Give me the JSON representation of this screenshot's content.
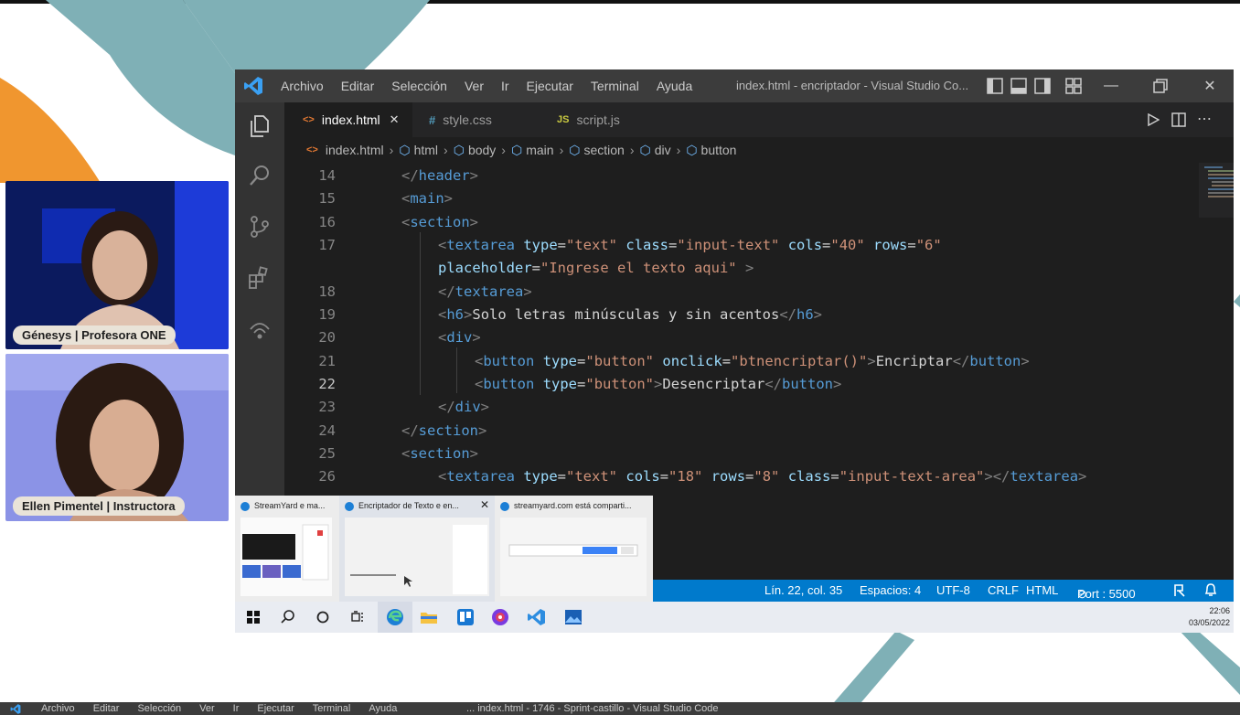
{
  "webcams": [
    {
      "name_tag": "Génesys | Profesora ONE"
    },
    {
      "name_tag": "Ellen Pimentel | Instructora"
    }
  ],
  "vscode": {
    "menu": [
      "Archivo",
      "Editar",
      "Selección",
      "Ver",
      "Ir",
      "Ejecutar",
      "Terminal",
      "Ayuda"
    ],
    "window_title": "index.html - encriptador - Visual Studio Co...",
    "tabs": [
      {
        "icon": "<>",
        "label": "index.html",
        "close": "✕",
        "active": true
      },
      {
        "icon": "#",
        "label": "style.css",
        "active": false
      },
      {
        "icon": "JS",
        "label": "script.js",
        "active": false
      }
    ],
    "breadcrumb": [
      "index.html",
      "html",
      "body",
      "main",
      "section",
      "div",
      "button"
    ],
    "line_numbers": [
      "14",
      "15",
      "16",
      "17",
      "",
      "18",
      "19",
      "20",
      "21",
      "22",
      "23",
      "24",
      "25",
      "26"
    ],
    "current_line": "22",
    "status": {
      "position": "Lín. 22, col. 35",
      "spaces": "Espacios: 4",
      "encoding": "UTF-8",
      "eol": "CRLF",
      "language": "HTML",
      "port": "Port : 5500"
    }
  },
  "taskbar": {
    "thumbnails": [
      {
        "title": "StreamYard e ma..."
      },
      {
        "title": "Encriptador de Texto e en...",
        "close": "✕"
      },
      {
        "title": "streamyard.com está comparti..."
      }
    ],
    "time": "22:06",
    "date": "03/05/2022"
  },
  "background_vscode": {
    "menu": [
      "Archivo",
      "Editar",
      "Selección",
      "Ver",
      "Ir",
      "Ejecutar",
      "Terminal",
      "Ayuda"
    ],
    "title": "... index.html - 1746 - Sprint-castillo - Visual Studio Code"
  },
  "colors": {
    "accent_teal": "#7fb0b6",
    "accent_orange": "#f0962f",
    "statusbar_blue": "#007acc",
    "vscode_bg": "#1e1e1e"
  }
}
